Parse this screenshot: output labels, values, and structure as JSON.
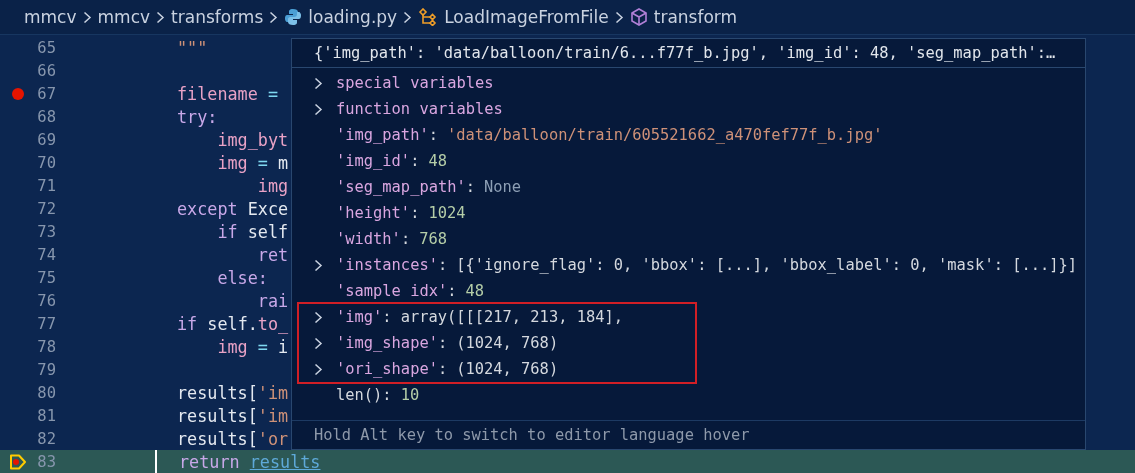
{
  "breadcrumbs": [
    {
      "label": "mmcv",
      "kind": "folder"
    },
    {
      "label": "mmcv",
      "kind": "folder"
    },
    {
      "label": "transforms",
      "kind": "folder"
    },
    {
      "label": "loading.py",
      "kind": "python"
    },
    {
      "label": "LoadImageFromFile",
      "kind": "class"
    },
    {
      "label": "transform",
      "kind": "method"
    }
  ],
  "editor": {
    "lines": [
      {
        "number": "65",
        "breakpoint": false,
        "current": false,
        "tokens": [
          {
            "t": "\"\"\"",
            "kind": "string"
          }
        ]
      },
      {
        "number": "66",
        "breakpoint": false,
        "current": false
      },
      {
        "number": "67",
        "breakpoint": true,
        "current": false,
        "tokens": [
          {
            "t": "filename",
            "kind": "var"
          },
          {
            "t": " =",
            "kind": "op"
          }
        ]
      },
      {
        "number": "68",
        "breakpoint": false,
        "current": false,
        "tokens": [
          {
            "t": "try:",
            "kind": "keyword"
          }
        ]
      },
      {
        "number": "69",
        "breakpoint": false,
        "current": false,
        "tokens": [
          {
            "t": "    img_byt",
            "kind": "var"
          }
        ]
      },
      {
        "number": "70",
        "breakpoint": false,
        "current": false,
        "tokens": [
          {
            "t": "    img",
            "kind": "var"
          },
          {
            "t": " = ",
            "kind": "op"
          },
          {
            "t": "m",
            "kind": "plain"
          }
        ]
      },
      {
        "number": "71",
        "breakpoint": false,
        "current": false,
        "tokens": [
          {
            "t": "        img",
            "kind": "var"
          }
        ]
      },
      {
        "number": "72",
        "breakpoint": false,
        "current": false,
        "tokens": [
          {
            "t": "except",
            "kind": "keyword"
          },
          {
            "t": " Exce",
            "kind": "plain"
          }
        ]
      },
      {
        "number": "73",
        "breakpoint": false,
        "current": false,
        "tokens": [
          {
            "t": "    if",
            "kind": "keyword"
          },
          {
            "t": " self",
            "kind": "plain"
          }
        ]
      },
      {
        "number": "74",
        "breakpoint": false,
        "current": false,
        "tokens": [
          {
            "t": "        ret",
            "kind": "keyword"
          }
        ]
      },
      {
        "number": "75",
        "breakpoint": false,
        "current": false,
        "tokens": [
          {
            "t": "    else:",
            "kind": "keyword"
          }
        ]
      },
      {
        "number": "76",
        "breakpoint": false,
        "current": false,
        "tokens": [
          {
            "t": "        rai",
            "kind": "keyword"
          }
        ]
      },
      {
        "number": "77",
        "breakpoint": false,
        "current": false,
        "tokens": [
          {
            "t": "if",
            "kind": "keyword"
          },
          {
            "t": " self.",
            "kind": "plain"
          },
          {
            "t": "to_",
            "kind": "var"
          }
        ]
      },
      {
        "number": "78",
        "breakpoint": false,
        "current": false,
        "tokens": [
          {
            "t": "    img",
            "kind": "var"
          },
          {
            "t": " = ",
            "kind": "op"
          },
          {
            "t": "i",
            "kind": "plain"
          }
        ]
      },
      {
        "number": "79",
        "breakpoint": false,
        "current": false
      },
      {
        "number": "80",
        "breakpoint": false,
        "current": false,
        "tokens": [
          {
            "t": "results[",
            "kind": "plain"
          },
          {
            "t": "'im",
            "kind": "string"
          }
        ]
      },
      {
        "number": "81",
        "breakpoint": false,
        "current": false,
        "tokens": [
          {
            "t": "results[",
            "kind": "plain"
          },
          {
            "t": "'im",
            "kind": "string"
          }
        ]
      },
      {
        "number": "82",
        "breakpoint": false,
        "current": false,
        "tokens": [
          {
            "t": "results[",
            "kind": "plain"
          },
          {
            "t": "'or",
            "kind": "string"
          }
        ]
      },
      {
        "number": "83",
        "breakpoint": true,
        "current": true,
        "tokens": [
          {
            "t": "return ",
            "kind": "keyword"
          },
          {
            "t": "results",
            "kind": "link"
          }
        ]
      }
    ]
  },
  "hover": {
    "summary": "{'img_path': 'data/balloon/train/6...f77f_b.jpg', 'img_id': 48, 'seg_map_path':…",
    "rows": [
      {
        "expandable": true,
        "highlighted": false,
        "kind": "group",
        "label": "special variables"
      },
      {
        "expandable": true,
        "highlighted": false,
        "kind": "group",
        "label": "function variables"
      },
      {
        "expandable": false,
        "highlighted": false,
        "kind": "entry",
        "key": "'img_path'",
        "sep": ":",
        "value": {
          "text": "'data/balloon/train/605521662_a470fef77f_b.jpg'",
          "kind": "string"
        }
      },
      {
        "expandable": false,
        "highlighted": false,
        "kind": "entry",
        "key": "'img_id'",
        "sep": ":",
        "value": {
          "text": "48",
          "kind": "number"
        }
      },
      {
        "expandable": false,
        "highlighted": false,
        "kind": "entry",
        "key": "'seg_map_path'",
        "sep": ":",
        "value": {
          "text": "None",
          "kind": "none"
        }
      },
      {
        "expandable": false,
        "highlighted": false,
        "kind": "entry",
        "key": "'height'",
        "sep": ":",
        "value": {
          "text": "1024",
          "kind": "number"
        }
      },
      {
        "expandable": false,
        "highlighted": false,
        "kind": "entry",
        "key": "'width'",
        "sep": ":",
        "value": {
          "text": "768",
          "kind": "number"
        }
      },
      {
        "expandable": true,
        "highlighted": false,
        "kind": "entry",
        "key": "'instances'",
        "sep": ":",
        "value": {
          "text": "[{'ignore_flag': 0, 'bbox': [...], 'bbox_label': 0, 'mask': [...]}]",
          "kind": "plain"
        }
      },
      {
        "expandable": false,
        "highlighted": false,
        "kind": "entry",
        "key": "'sample idx'",
        "sep": ":",
        "value": {
          "text": "48",
          "kind": "number"
        }
      },
      {
        "expandable": true,
        "highlighted": true,
        "kind": "entry",
        "key": "'img'",
        "sep": ":",
        "value": {
          "text": "array([[[217, 213, 184],",
          "kind": "plain"
        }
      },
      {
        "expandable": true,
        "highlighted": true,
        "kind": "entry",
        "key": "'img_shape'",
        "sep": ":",
        "value": {
          "text": "(1024, 768)",
          "kind": "plain"
        }
      },
      {
        "expandable": true,
        "highlighted": true,
        "kind": "entry",
        "key": "'ori_shape'",
        "sep": ":",
        "value": {
          "text": "(1024, 768)",
          "kind": "plain"
        }
      },
      {
        "expandable": false,
        "highlighted": false,
        "kind": "len",
        "key": "len()",
        "sep": ":",
        "value": {
          "text": "10",
          "kind": "number"
        }
      }
    ],
    "footer": "Hold Alt key to switch to editor language hover"
  }
}
